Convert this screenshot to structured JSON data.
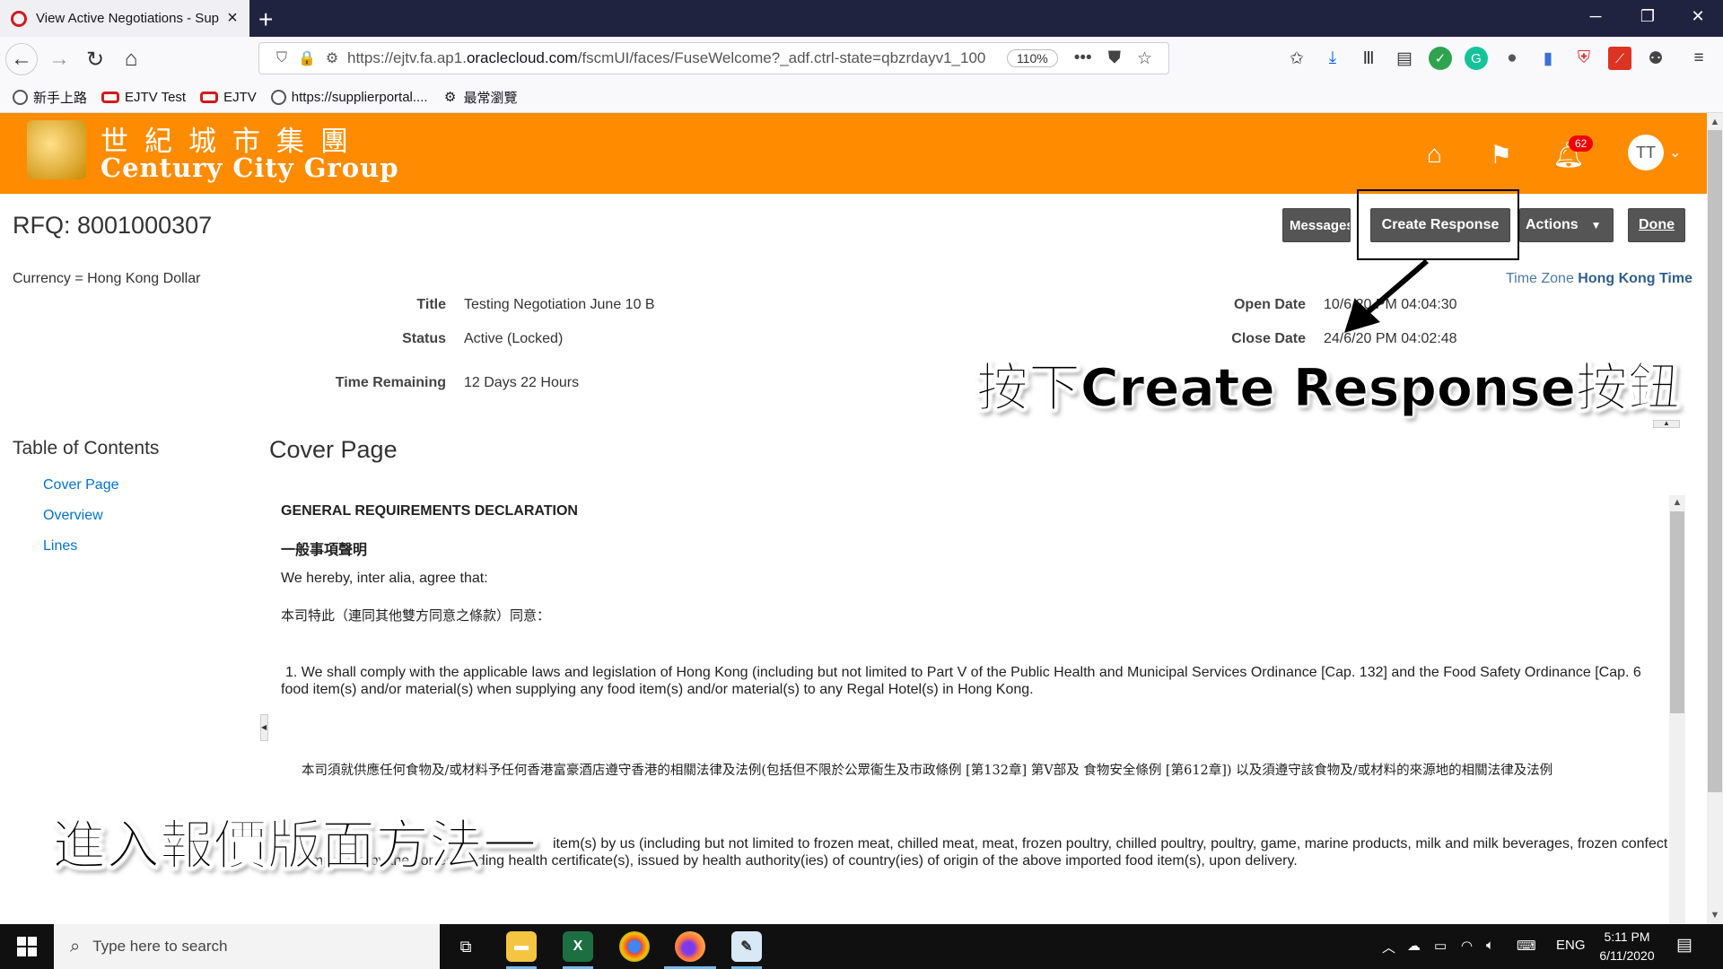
{
  "browser": {
    "tab_title": "View Active Negotiations - Sup",
    "url_prefix": "https://ejtv.fa.ap1.",
    "url_domain": "oraclecloud.com",
    "url_path": "/fscmUI/faces/FuseWelcome?_adf.ctrl-state=qbzrdayv1_100",
    "zoom": "110%",
    "bookmarks": [
      "新手上路",
      "EJTV Test",
      "EJTV",
      "https://supplierportal....",
      "最常瀏覽"
    ]
  },
  "header": {
    "logo_cn": "世紀城市集團",
    "logo_en": "Century City Group",
    "notification_count": "62",
    "avatar_initials": "TT"
  },
  "page": {
    "title": "RFQ: 8001000307",
    "buttons": {
      "messages": "Messages",
      "create_response": "Create Response",
      "actions": "Actions",
      "done": "Done"
    },
    "currency": "Currency = Hong Kong Dollar",
    "timezone_label": "Time Zone",
    "timezone_value": "Hong Kong Time",
    "fields": {
      "title_label": "Title",
      "title_value": "Testing Negotiation June 10 B",
      "status_label": "Status",
      "status_value": "Active (Locked)",
      "remaining_label": "Time Remaining",
      "remaining_value": "12 Days 22 Hours",
      "open_label": "Open Date",
      "open_value": "10/6/20 PM 04:04:30",
      "close_label": "Close Date",
      "close_value": "24/6/20 PM 04:02:48"
    }
  },
  "toc": {
    "title": "Table of Contents",
    "links": [
      "Cover Page",
      "Overview",
      "Lines"
    ]
  },
  "cover": {
    "title": "Cover Page",
    "heading_en": "GENERAL REQUIREMENTS DECLARATION",
    "heading_cn": "一般事項聲明",
    "agree_en": "We hereby, inter alia, agree that:",
    "agree_cn": "本司特此（連同其他雙方同意之條款）同意：",
    "item1_line1": "1. We shall comply with the applicable laws and legislation of Hong Kong (including but not limited to Part V of the Public Health and Municipal Services Ordinance [Cap. 132] and the Food Safety Ordinance [Cap. 6",
    "item1_line2": "food item(s) and/or material(s) when supplying any food item(s) and/or material(s) to any Regal Hotel(s) in Hong Kong.",
    "item1_cn": "本司須就供應任何食物及/或材料予任何香港富豪酒店遵守香港的相關法律及法例(包括但不限於公眾衞生及市政條例 [第132章] 第V部及 食物安全條例 [第612章]) 以及須遵守該食物及/或材料的來源地的相關法律及法例",
    "item2_line1": "item(s) by us (including but not limited to frozen meat, chilled meat, meat, frozen poultry, chilled poultry, poultry, game, marine products, milk and milk beverages, frozen confections a",
    "item2_line2": "accompanied by the corresponding health certificate(s), issued by health authority(ies) of country(ies) of origin of the above imported food item(s), upon delivery."
  },
  "annotations": {
    "callout": "按下Create Response按鈕",
    "method": "進入報價版面方法一"
  },
  "taskbar": {
    "search_placeholder": "Type here to search",
    "language": "ENG",
    "time": "5:11 PM",
    "date": "6/11/2020"
  },
  "colors": {
    "header_orange": "#ff8c00",
    "link_blue": "#0572ce",
    "button_gray": "#555555"
  }
}
